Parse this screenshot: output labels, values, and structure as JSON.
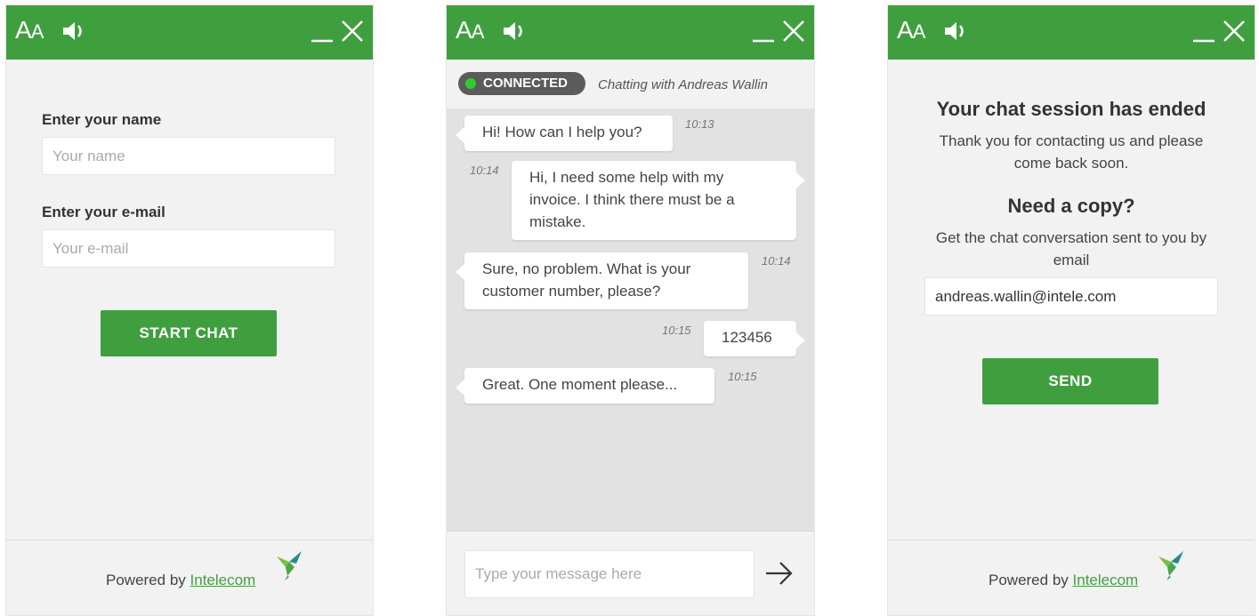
{
  "header": {
    "font_size_label_big": "A",
    "font_size_label_small": "A"
  },
  "colors": {
    "brand_green": "#3f9f3f",
    "connected_dot": "#2ecc2e"
  },
  "icons": [
    "font-size-icon",
    "speaker-icon",
    "minimize-icon",
    "close-icon",
    "send-arrow-icon",
    "hummingbird-logo-icon"
  ],
  "start_form": {
    "name_label": "Enter your name",
    "name_placeholder": "Your name",
    "email_label": "Enter your e-mail",
    "email_placeholder": "Your e-mail",
    "start_button": "START CHAT"
  },
  "footer": {
    "powered_prefix": "Powered by",
    "brand_link": "Intelecom"
  },
  "chat": {
    "status": "CONNECTED",
    "chatting_with": "Chatting with Andreas Wallin",
    "messages": [
      {
        "from": "agent",
        "text": "Hi! How can I help you?",
        "time": "10:13"
      },
      {
        "from": "user",
        "text": "Hi, I need some help with my invoice. I think there must be a mistake.",
        "time": "10:14"
      },
      {
        "from": "agent",
        "text": "Sure, no problem. What is your customer number, please?",
        "time": "10:14"
      },
      {
        "from": "user",
        "text": "123456",
        "time": "10:15"
      },
      {
        "from": "agent",
        "text": "Great. One moment please...",
        "time": "10:15"
      }
    ],
    "input_placeholder": "Type your message here"
  },
  "ended": {
    "title": "Your chat session has ended",
    "thanks": "Thank you for contacting us and please come back soon.",
    "copy_title": "Need a copy?",
    "copy_text": "Get the chat conversation sent to you by email",
    "email_value": "andreas.wallin@intele.com",
    "send_button": "SEND"
  }
}
